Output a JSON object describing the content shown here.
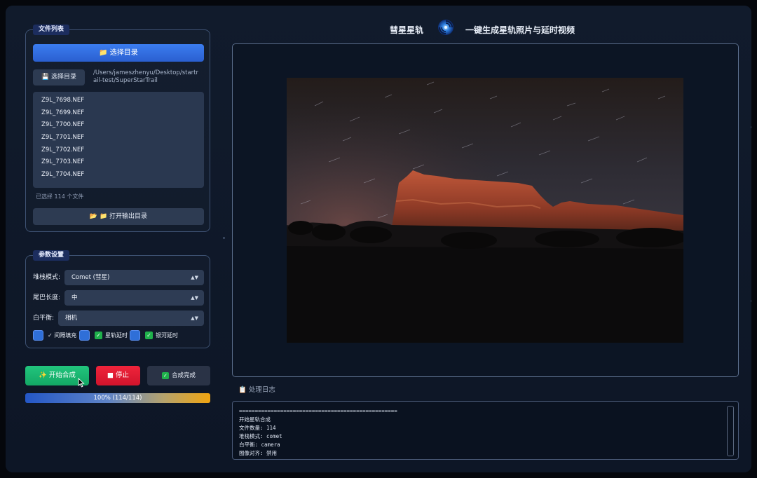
{
  "app": {
    "title_left": "彗星星轨",
    "title_right": "一键生成星轨照片与延时视频",
    "logo_icon": "swirl-galaxy-icon"
  },
  "files": {
    "legend": "文件列表",
    "select_dir_label": "📁 选择目录",
    "select_dir_small_label": "💾 选择目录",
    "path": "/Users/jameszhenyu/Desktop/startrail-test/SuperStarTrail",
    "items": [
      "Z9L_7698.NEF",
      "Z9L_7699.NEF",
      "Z9L_7700.NEF",
      "Z9L_7701.NEF",
      "Z9L_7702.NEF",
      "Z9L_7703.NEF",
      "Z9L_7704.NEF"
    ],
    "selected_count": "已选择 114 个文件",
    "open_output_label": "📂 📁 打开输出目录"
  },
  "params": {
    "legend": "参数设置",
    "stack_mode_label": "堆栈模式:",
    "stack_mode_value": "Comet (彗星)",
    "tail_length_label": "尾巴长度:",
    "tail_length_value": "中",
    "white_balance_label": "白平衡:",
    "white_balance_value": "相机",
    "gap_fill_label": "✓ 间隔填充",
    "startrail_timelapse_label": "星轨延时",
    "milkyway_timelapse_label": "银河延时",
    "arrow_glyph": "▲▼"
  },
  "actions": {
    "start_label": "✨ 开始合成",
    "stop_label": "■ 停止",
    "done_label": "合成完成",
    "check_glyph": "✓"
  },
  "progress": {
    "percent": 100,
    "text": "100% (114/114)"
  },
  "log": {
    "header": "📋 处理日志",
    "lines": [
      "==================================================",
      "开始星轨合成",
      "文件数量: 114",
      "堆栈模式: comet",
      "白平衡: camera",
      "图像对齐: 禁用"
    ]
  },
  "colors": {
    "accent_blue": "#2f6fd8",
    "start_green": "#13a765",
    "stop_red": "#d0142c",
    "progress_end": "#f0a410"
  }
}
